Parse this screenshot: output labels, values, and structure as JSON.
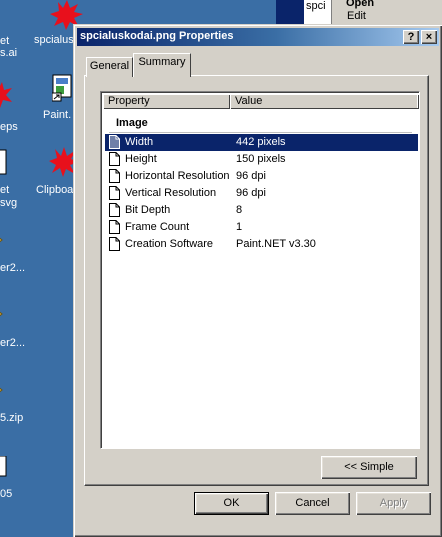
{
  "desktop": {
    "icons": [
      {
        "label": "et"
      },
      {
        "label": "spcialus"
      },
      {
        "label": "s.ai"
      },
      {
        "label": "Paint."
      },
      {
        "label": "eps"
      },
      {
        "label": "et"
      },
      {
        "label": "Clipboa"
      },
      {
        "label": "svg"
      },
      {
        "label": "er2..."
      },
      {
        "label": "er2..."
      },
      {
        "label": "5.zip"
      },
      {
        "label": "05"
      }
    ]
  },
  "background_window": {
    "tab_label": "spci",
    "menu_open": "Open",
    "menu_edit": "Edit"
  },
  "dialog": {
    "title": "spcialuskodai.png Properties",
    "help_button": "?",
    "close_button": "×",
    "tabs": [
      {
        "label": "General",
        "active": false
      },
      {
        "label": "Summary",
        "active": true
      }
    ],
    "columns": {
      "property": "Property",
      "value": "Value"
    },
    "group": "Image",
    "rows": [
      {
        "property": "Width",
        "value": "442 pixels",
        "selected": true
      },
      {
        "property": "Height",
        "value": "150 pixels",
        "selected": false
      },
      {
        "property": "Horizontal Resolution",
        "value": "96 dpi",
        "selected": false
      },
      {
        "property": "Vertical Resolution",
        "value": "96 dpi",
        "selected": false
      },
      {
        "property": "Bit Depth",
        "value": "8",
        "selected": false
      },
      {
        "property": "Frame Count",
        "value": "1",
        "selected": false
      },
      {
        "property": "Creation Software",
        "value": "Paint.NET v3.30",
        "selected": false
      }
    ],
    "simple_button": "<< Simple",
    "ok_button": "OK",
    "cancel_button": "Cancel",
    "apply_button": "Apply"
  },
  "colors": {
    "desktop": "#3a6ea5",
    "titlebar_start": "#0a246a",
    "selection": "#0a246a",
    "face": "#d4d0c8",
    "icon_red": "#e8101c"
  }
}
